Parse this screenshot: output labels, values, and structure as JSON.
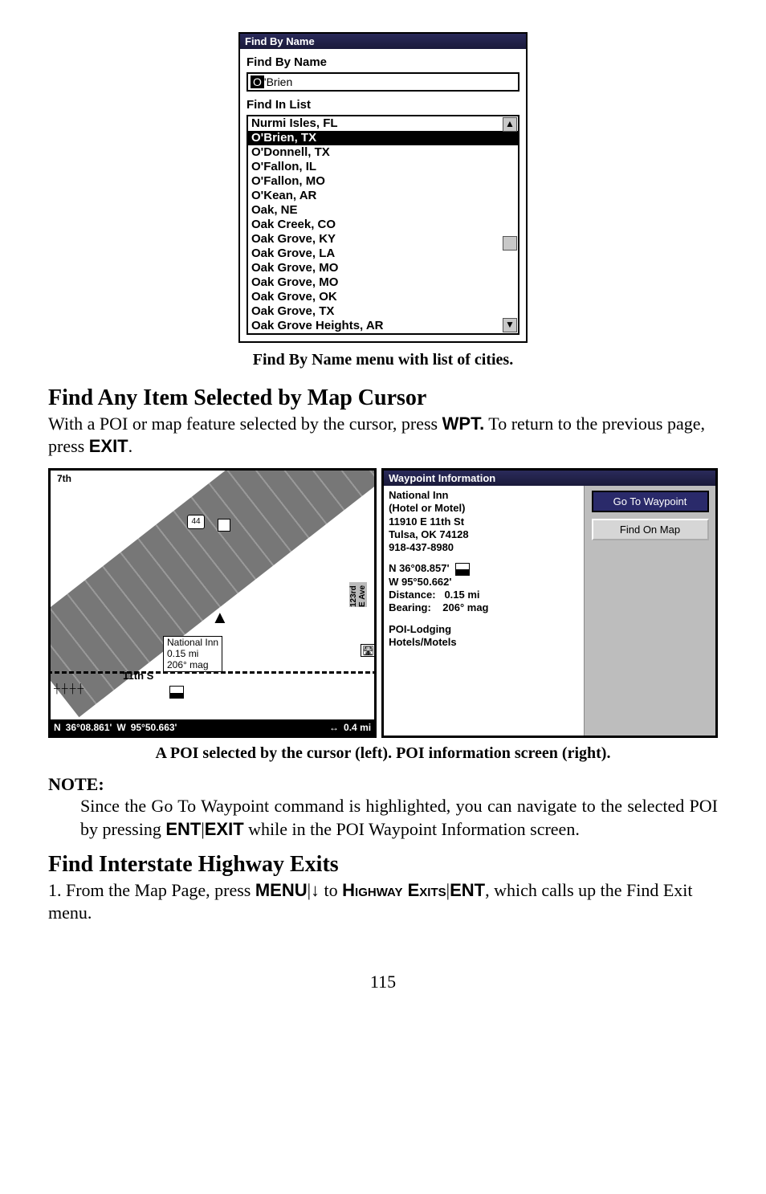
{
  "findByName": {
    "title": "Find By Name",
    "label": "Find By Name",
    "input_prefix": "O",
    "input_suffix": "'Brien",
    "listLabel": "Find In List",
    "items": [
      "Nurmi Isles, FL",
      "O'Brien, TX",
      "O'Donnell, TX",
      "O'Fallon, IL",
      "O'Fallon, MO",
      "O'Kean, AR",
      "Oak, NE",
      "Oak Creek, CO",
      "Oak Grove, KY",
      "Oak Grove, LA",
      "Oak Grove, MO",
      "Oak Grove, MO",
      "Oak Grove, OK",
      "Oak Grove, TX",
      "Oak Grove Heights, AR"
    ],
    "highlight_index": 1
  },
  "caption1": "Find By Name menu with list of cities.",
  "section1": "Find Any Item Selected by Map Cursor",
  "para1_a": "With a POI or map feature selected by the cursor, press ",
  "para1_key1": "WPT.",
  "para1_b": " To return to the previous page, press ",
  "para1_key2": "EXIT",
  "para1_c": ".",
  "map": {
    "shield1": "44",
    "poi_box": [
      "National Inn",
      "0.15 mi",
      "206° mag"
    ],
    "street_11th_left": "11th S",
    "street_vertical": "123rd E Ave",
    "north": "▲",
    "hwy_top": "7th",
    "coords": {
      "n1": "N",
      "lat": "36°08.861'",
      "h": "W",
      "lon": "95°50.663'",
      "arrows": "↔",
      "scale": "0.4 mi"
    }
  },
  "wp": {
    "title": "Waypoint Information",
    "lines": [
      "National Inn",
      "(Hotel or Motel)",
      "11910 E 11th St",
      "Tulsa, OK 74128",
      "918-437-8980"
    ],
    "coord_n": "N   36°08.857'",
    "coord_w": "W   95°50.662'",
    "dist_label": "Distance:",
    "dist_val": "0.15 mi",
    "bear_label": "Bearing:",
    "bear_val": "206° mag",
    "cat1": "POI-Lodging",
    "cat2": "Hotels/Motels",
    "btn_goto": "Go To Waypoint",
    "btn_find": "Find On Map"
  },
  "caption2": "A POI selected by the cursor (left). POI information screen (right).",
  "note_label": "NOTE:",
  "note_body_a": "Since the Go To Waypoint command is highlighted, you can navigate to the selected POI by pressing ",
  "note_key1": "ENT",
  "note_sep": "|",
  "note_key2": "EXIT",
  "note_body_b": " while in the POI Waypoint Information screen.",
  "section2": "Find Interstate Highway Exits",
  "para2_a": "1. From the Map Page, press ",
  "para2_key_menu": "MENU",
  "para2_sep1": "|",
  "para2_arrow": "↓",
  "para2_to": " to ",
  "para2_sc": "Highway Exits",
  "para2_sep2": "|",
  "para2_key_ent": "ENT",
  "para2_b": ", which calls up the Find Exit menu.",
  "pagenum": "115"
}
